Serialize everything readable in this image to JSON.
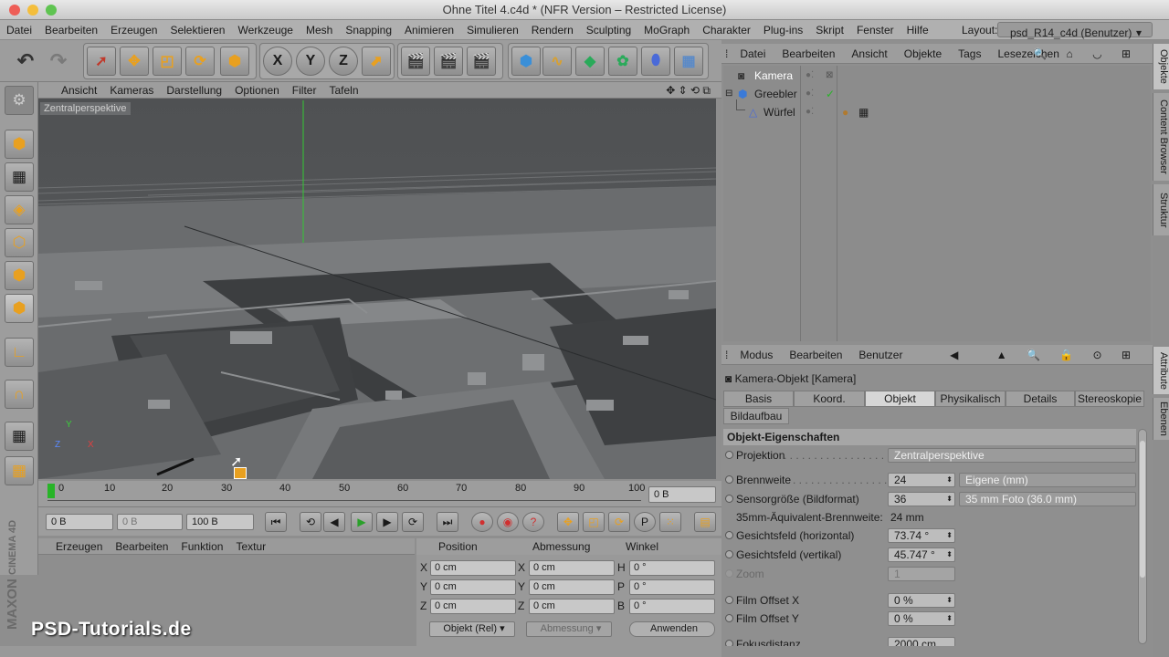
{
  "window": {
    "title": "Ohne Titel 4.c4d * (NFR Version – Restricted License)"
  },
  "menubar": {
    "items": [
      "Datei",
      "Bearbeiten",
      "Erzeugen",
      "Selektieren",
      "Werkzeuge",
      "Mesh",
      "Snapping",
      "Animieren",
      "Simulieren",
      "Rendern",
      "Sculpting",
      "MoGraph",
      "Charakter",
      "Plug-ins",
      "Skript",
      "Fenster",
      "Hilfe"
    ],
    "layout_label": "Layout:",
    "layout_value": "psd_R14_c4d (Benutzer)"
  },
  "toolbar": {
    "axis_x": "X",
    "axis_y": "Y",
    "axis_z": "Z"
  },
  "viewport": {
    "menu": [
      "Ansicht",
      "Kameras",
      "Darstellung",
      "Optionen",
      "Filter",
      "Tafeln"
    ],
    "label": "Zentralperspektive",
    "axis_labels": {
      "y": "Y",
      "z": "Z",
      "x": "X"
    }
  },
  "timeline": {
    "ticks": [
      "0",
      "10",
      "20",
      "30",
      "40",
      "50",
      "60",
      "70",
      "80",
      "90",
      "100"
    ],
    "current_frame": "0 B"
  },
  "playback": {
    "start": "0 B",
    "preview": "0 B",
    "end": "100 B"
  },
  "material_manager": {
    "menu": [
      "Erzeugen",
      "Bearbeiten",
      "Funktion",
      "Textur"
    ]
  },
  "coordinates": {
    "headers": [
      "Position",
      "Abmessung",
      "Winkel"
    ],
    "rows": [
      {
        "a": "X",
        "pos": "0 cm",
        "b": "X",
        "size": "0 cm",
        "c": "H",
        "angle": "0 °"
      },
      {
        "a": "Y",
        "pos": "0 cm",
        "b": "Y",
        "size": "0 cm",
        "c": "P",
        "angle": "0 °"
      },
      {
        "a": "Z",
        "pos": "0 cm",
        "b": "Z",
        "size": "0 cm",
        "c": "B",
        "angle": "0 °"
      }
    ],
    "mode": "Objekt (Rel)",
    "size_mode": "Abmessung",
    "apply": "Anwenden"
  },
  "object_manager": {
    "menu": [
      "Datei",
      "Bearbeiten",
      "Ansicht",
      "Objekte",
      "Tags",
      "Lesezeichen"
    ],
    "objects": [
      {
        "name": "Kamera"
      },
      {
        "name": "Greebler"
      },
      {
        "name": "Würfel"
      }
    ]
  },
  "attribute_manager": {
    "menu": [
      "Modus",
      "Bearbeiten",
      "Benutzer"
    ],
    "object_title": "Kamera-Objekt [Kamera]",
    "tabs": [
      "Basis",
      "Koord.",
      "Objekt",
      "Physikalisch",
      "Details",
      "Stereoskopie",
      "Bildaufbau"
    ],
    "active_tab": "Objekt",
    "section": "Objekt-Eigenschaften",
    "props": {
      "projektion_label": "Projektion",
      "projektion_value": "Zentralperspektive",
      "brennweite_label": "Brennweite",
      "brennweite_value": "24",
      "brennweite_option": "Eigene (mm)",
      "sensor_label": "Sensorgröße (Bildformat)",
      "sensor_value": "36",
      "sensor_option": "35 mm Foto (36.0 mm)",
      "aequiv_label": "35mm-Äquivalent-Brennweite:",
      "aequiv_value": "24 mm",
      "fov_h_label": "Gesichtsfeld (horizontal)",
      "fov_h_value": "73.74 °",
      "fov_v_label": "Gesichtsfeld (vertikal)",
      "fov_v_value": "45.747 °",
      "zoom_label": "Zoom",
      "zoom_value": "1",
      "offx_label": "Film Offset X",
      "offx_value": "0 %",
      "offy_label": "Film Offset Y",
      "offy_value": "0 %",
      "fokus_label": "Fokusdistanz",
      "fokus_value": "2000 cm"
    }
  },
  "side_tabs": {
    "top": [
      "Objekte",
      "Content Browser",
      "Struktur"
    ],
    "bottom": [
      "Attribute",
      "Ebenen"
    ]
  },
  "branding": {
    "maxon": "MAXON",
    "cinema": "CINEMA 4D",
    "watermark": "PSD-Tutorials.de"
  },
  "colors": {
    "accent_green": "#28b428",
    "viewport_bg": "#4a4c4e",
    "selected_blue": "#5a7fc2"
  }
}
